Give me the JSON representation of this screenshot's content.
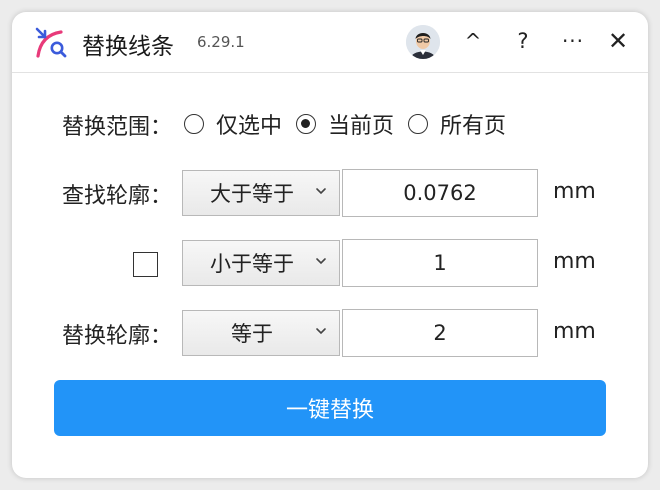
{
  "app": {
    "title": "替换线条",
    "version": "6.29.1"
  },
  "titlebar": {
    "collapse": "^",
    "help": "?",
    "more": "···",
    "close": "✕"
  },
  "scope": {
    "label": "替换范围：",
    "options": [
      {
        "label": "仅选中",
        "checked": false
      },
      {
        "label": "当前页",
        "checked": true
      },
      {
        "label": "所有页",
        "checked": false
      }
    ]
  },
  "find": {
    "label": "查找轮廓：",
    "condition1": {
      "operator": "大于等于",
      "value": "0.0762",
      "unit": "mm"
    },
    "condition2": {
      "enabled": false,
      "operator": "小于等于",
      "value": "1",
      "unit": "mm"
    }
  },
  "replace": {
    "label": "替换轮廓：",
    "operator": "等于",
    "value": "2",
    "unit": "mm"
  },
  "action": {
    "label": "一键替换"
  },
  "colors": {
    "accent": "#2294f8",
    "logo_pink": "#e83a7a",
    "logo_blue": "#3b5bdb"
  }
}
